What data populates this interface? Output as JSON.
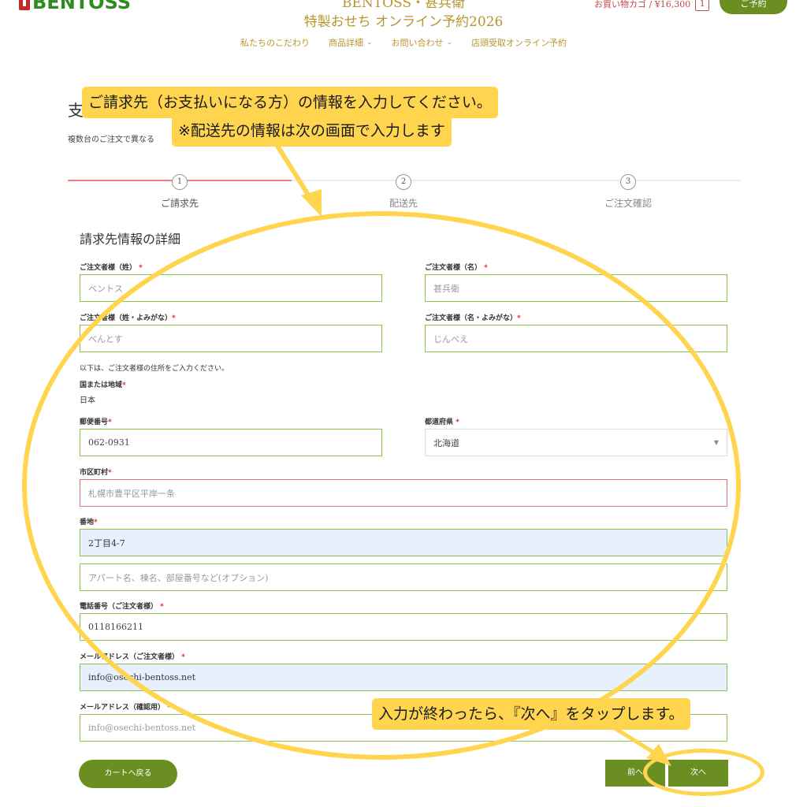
{
  "header": {
    "logo_text": "BENTOSS",
    "title_line1": "BENTOSS・甚兵衛",
    "title_line2": "特製おせち オンライン予約2026",
    "cart_label": "お買い物カゴ / ¥16,300",
    "cart_count": "1",
    "reserve_label": "ご予約"
  },
  "nav": [
    {
      "label": "私たちのこだわり",
      "has_chevron": false
    },
    {
      "label": "商品詳細",
      "has_chevron": true
    },
    {
      "label": "お問い合わせ",
      "has_chevron": true
    },
    {
      "label": "店頭受取オンライン予約",
      "has_chevron": false
    }
  ],
  "page": {
    "heading": "支",
    "subtext": "複数台のご注文で異なる",
    "section_title": "請求先情報の詳細"
  },
  "steps": [
    {
      "num": "1",
      "label": "ご請求先"
    },
    {
      "num": "2",
      "label": "配送先"
    },
    {
      "num": "3",
      "label": "ご注文確認"
    }
  ],
  "form": {
    "last_name_label": "ご注文者様（姓）",
    "last_name_value": "ベントス",
    "first_name_label": "ご注文者様（名）",
    "first_name_value": "甚兵衛",
    "last_kana_label": "ご注文者様（姓・よみがな）",
    "last_kana_value": "べんとす",
    "first_kana_label": "ご注文者様（名・よみがな）",
    "first_kana_value": "じんべえ",
    "address_note": "以下は、ご注文者様の住所をご入力ください。",
    "country_label": "国または地域",
    "country_value": "日本",
    "postal_label": "郵便番号",
    "postal_value": "062-0931",
    "pref_label": "都道府県",
    "pref_value": "北海道",
    "city_label": "市区町村",
    "city_placeholder": "札幌市豊平区平岸一条",
    "street_label": "番地",
    "street_value": "2丁目4-7",
    "apt_placeholder": "アパート名、棟名、部屋番号など(オプション)",
    "phone_label": "電話番号（ご注文者様）",
    "phone_value": "0118166211",
    "email_label": "メールアドレス（ご注文者様）",
    "email_value": "info@osechi-bentoss.net",
    "email_confirm_label": "メールアドレス（確認用）",
    "email_confirm_value": "info@osechi-bentoss.net",
    "required_mark": "*"
  },
  "buttons": {
    "back_to_cart": "カートへ戻る",
    "prev": "前へ",
    "next": "次へ"
  },
  "callouts": {
    "top_line1": "ご請求先（お支払いになる方）の情報を入力してください。",
    "top_line2": "※配送先の情報は次の画面で入力します",
    "bottom": "入力が終わったら、『次へ』をタップします。"
  },
  "colors": {
    "brand_green": "#6b8e23",
    "gold": "#b8962e",
    "highlight": "#ffd54f",
    "step_active": "#f08080"
  }
}
